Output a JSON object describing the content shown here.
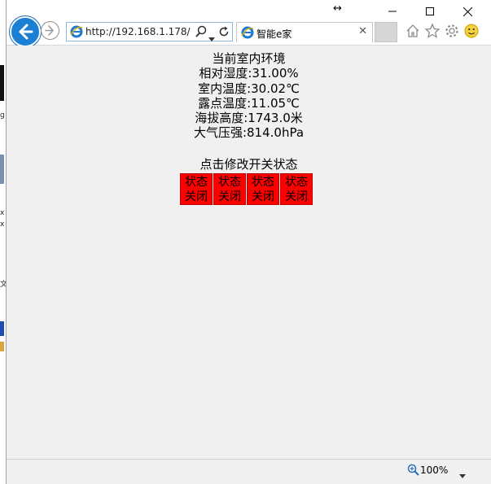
{
  "window": {
    "resize_indicator": "↔"
  },
  "navbar": {
    "address_url": "http://192.168.1.178/"
  },
  "tab": {
    "title": "智能e家"
  },
  "main": {
    "heading": "当前室内环境",
    "readings": [
      "相对湿度:31.00%",
      "室内温度:30.02℃",
      "露点温度:11.05℃",
      "海拔高度:1743.0米",
      "大气压强:814.0hPa"
    ],
    "switch_hint": "点击修改开关状态",
    "switches": [
      {
        "line1": "状态",
        "line2": "关闭"
      },
      {
        "line1": "状态",
        "line2": "关闭"
      },
      {
        "line1": "状态",
        "line2": "关闭"
      },
      {
        "line1": "状态",
        "line2": "关闭"
      }
    ],
    "switch_color": "#ff0000"
  },
  "statusbar": {
    "zoom": "100%"
  },
  "desktop": {
    "sliver_texts": [
      "g",
      "x",
      "x",
      "文"
    ]
  }
}
